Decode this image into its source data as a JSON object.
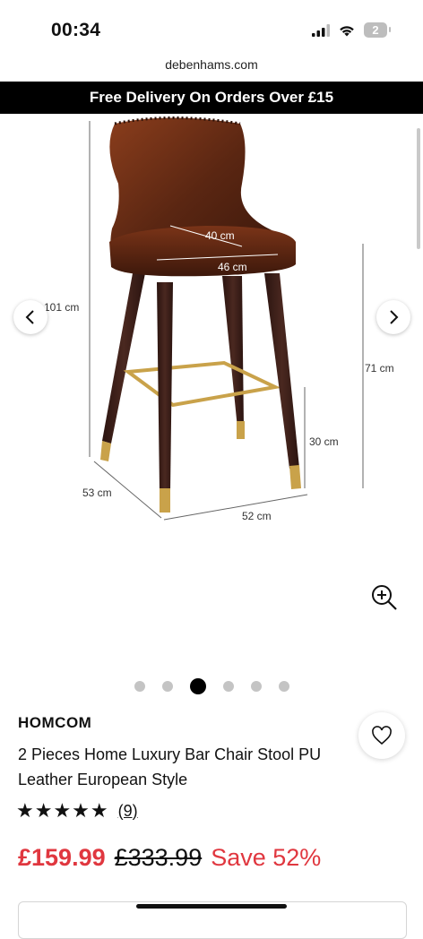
{
  "status_bar": {
    "time": "00:34",
    "battery_level": "2"
  },
  "browser": {
    "url": "debenhams.com"
  },
  "promo_banner": {
    "text": "Free Delivery On Orders Over £15"
  },
  "gallery": {
    "dimensions": {
      "seat_depth": "40 cm",
      "seat_width": "46 cm",
      "total_height": "101 cm",
      "seat_height": "71 cm",
      "footrest_height": "30 cm",
      "base_depth": "53 cm",
      "base_width": "52 cm"
    },
    "current_image": 3,
    "total_images": 6,
    "icons": {
      "prev": "chevron-left-icon",
      "next": "chevron-right-icon",
      "zoom": "zoom-in-icon"
    }
  },
  "product": {
    "brand": "HOMCOM",
    "title": "2 Pieces Home Luxury Bar Chair Stool PU Leather European Style",
    "rating_stars": "★★★★★",
    "rating_value": 5,
    "review_count": "(9)",
    "price_current": "£159.99",
    "price_original": "£333.99",
    "savings": "Save 52%"
  },
  "colors": {
    "accent_red": "#e0373f",
    "banner_bg": "#000000"
  }
}
